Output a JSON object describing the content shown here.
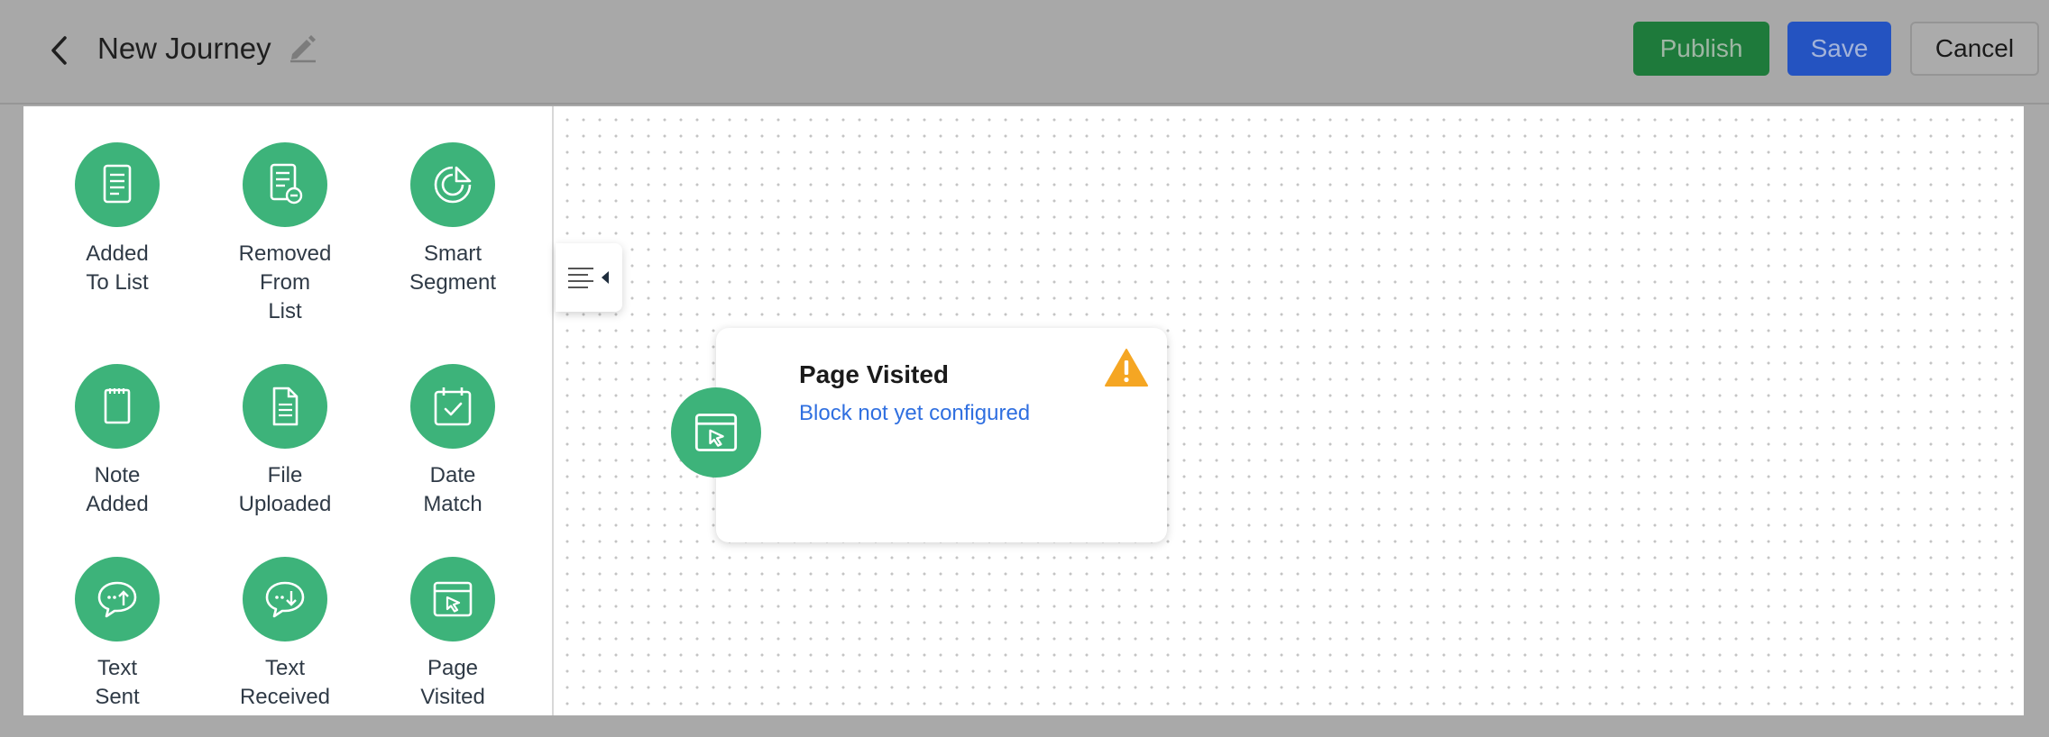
{
  "header": {
    "title": "New Journey",
    "back_icon": "chevron-left-icon",
    "edit_icon": "pencil-icon",
    "publish_label": "Publish",
    "save_label": "Save",
    "cancel_label": "Cancel"
  },
  "palette": {
    "items": [
      {
        "label": "Added\nTo List",
        "icon": "list-document-icon"
      },
      {
        "label": "Removed\nFrom\nList",
        "icon": "list-remove-icon"
      },
      {
        "label": "Smart\nSegment",
        "icon": "pie-segment-icon"
      },
      {
        "label": "Note\nAdded",
        "icon": "note-icon"
      },
      {
        "label": "File\nUploaded",
        "icon": "file-icon"
      },
      {
        "label": "Date\nMatch",
        "icon": "calendar-check-icon"
      },
      {
        "label": "Text\nSent",
        "icon": "chat-send-icon"
      },
      {
        "label": "Text\nReceived",
        "icon": "chat-receive-icon"
      },
      {
        "label": "Page\nVisited",
        "icon": "browser-cursor-icon"
      }
    ]
  },
  "canvas": {
    "collapse_icon": "collapse-panel-icon",
    "node": {
      "title": "Page Visited",
      "subtitle": "Block not yet configured",
      "icon": "browser-cursor-icon",
      "status_icon": "warning-icon"
    }
  },
  "colors": {
    "accent_green": "#3db37a",
    "publish": "#1e7a3b",
    "save": "#2453c1",
    "link_blue": "#2f6fe0",
    "warning": "#f5a623"
  }
}
